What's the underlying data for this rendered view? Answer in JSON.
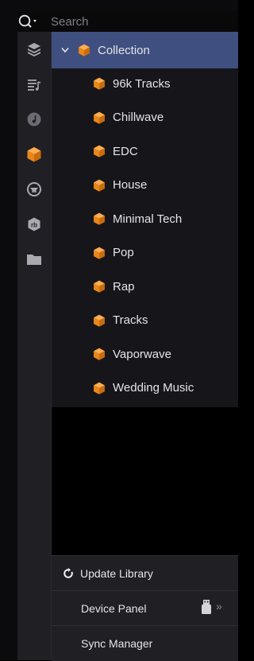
{
  "search": {
    "placeholder": "Search"
  },
  "rail": {
    "icons": [
      "library-icon",
      "playlist-icon",
      "music-icon",
      "collection-cube-icon",
      "soundcloud-icon",
      "rekordbox-icon",
      "folder-icon"
    ]
  },
  "tree": {
    "root": {
      "label": "Collection"
    },
    "items": [
      {
        "label": "96k Tracks"
      },
      {
        "label": "Chillwave"
      },
      {
        "label": "EDC"
      },
      {
        "label": "House"
      },
      {
        "label": "Minimal Tech"
      },
      {
        "label": "Pop"
      },
      {
        "label": "Rap"
      },
      {
        "label": "Tracks"
      },
      {
        "label": "Vaporwave"
      },
      {
        "label": "Wedding Music"
      }
    ]
  },
  "bottom": {
    "update_label": "Update Library",
    "device_label": "Device Panel",
    "sync_label": "Sync Manager",
    "more_glyph": "»"
  },
  "colors": {
    "accent": "#3f4f7f",
    "cube": "#f08a1c"
  }
}
